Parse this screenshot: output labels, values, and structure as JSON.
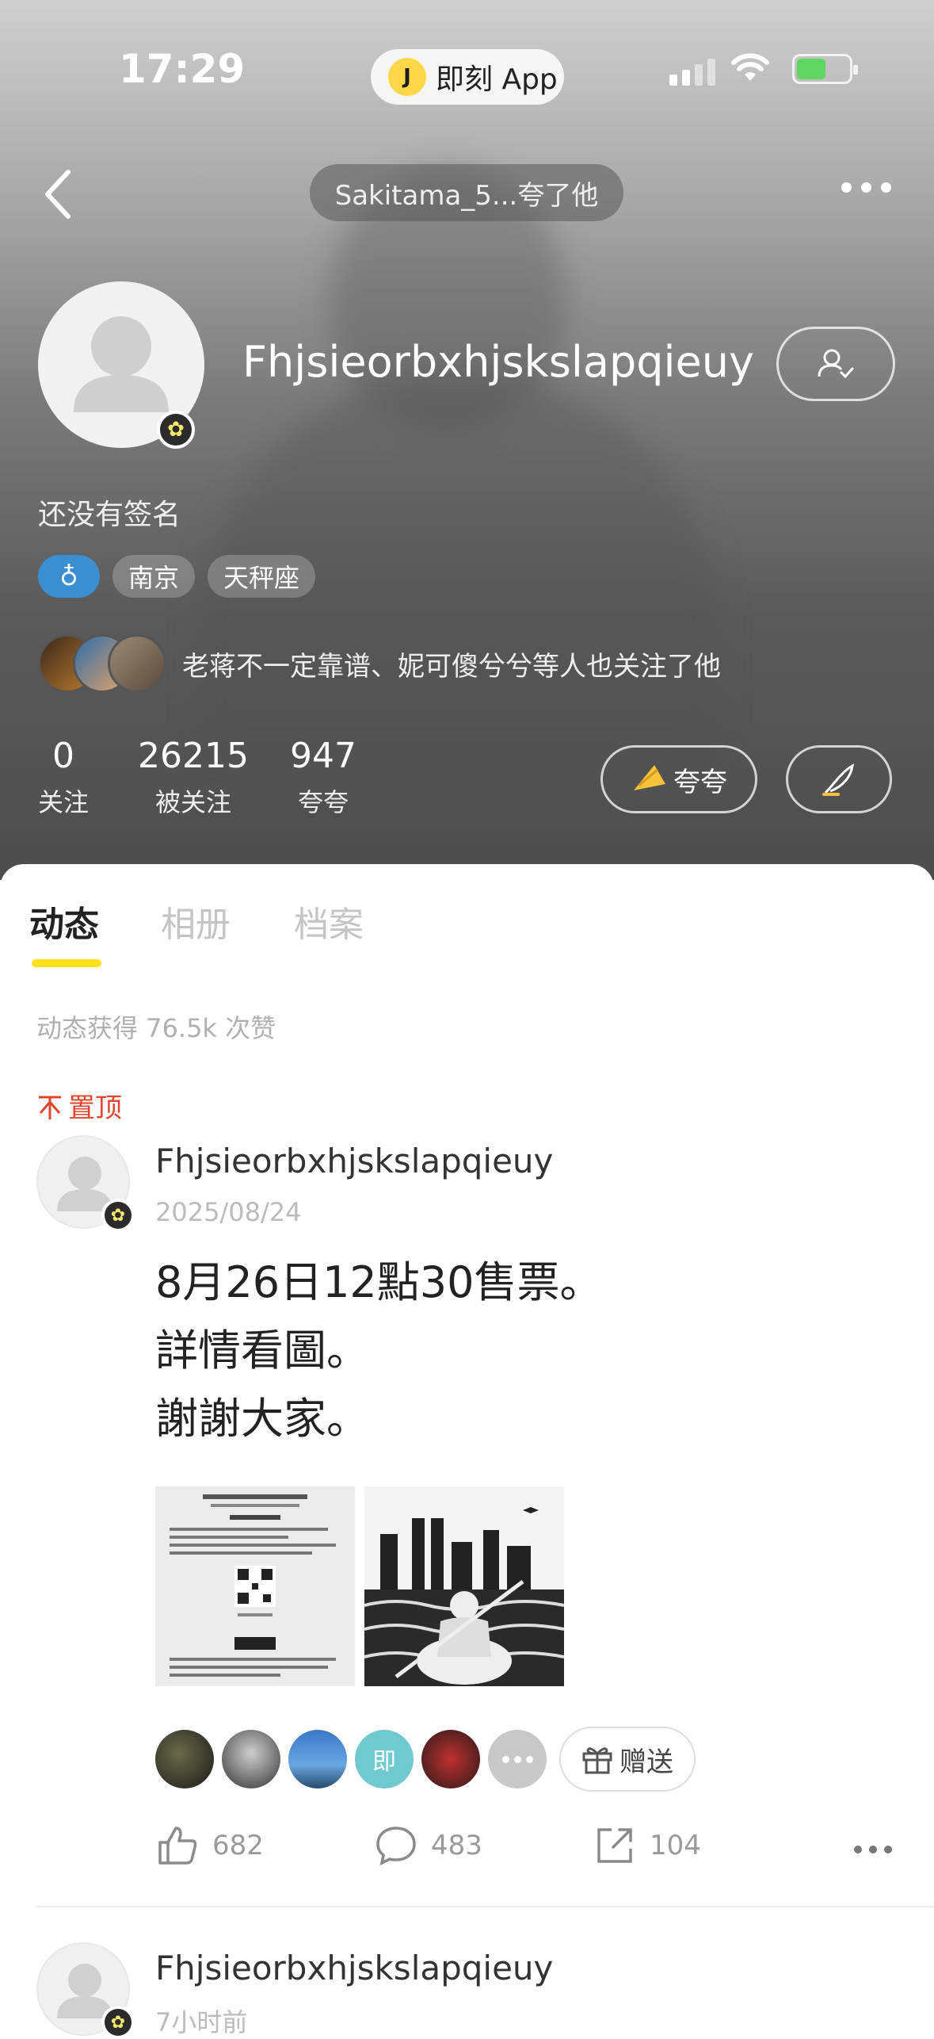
{
  "status_bar": {
    "time": "17:29",
    "app_pill": "即刻 App"
  },
  "nav": {
    "title_pill": "Sakitama_5...夸了他"
  },
  "profile": {
    "username": "Fhjsieorbxhjskslapqieuy",
    "bio": "还没有签名",
    "tags": [
      "♁",
      "南京",
      "天秤座"
    ],
    "mutual_text": "老蒋不一定靠谱、妮可傻兮兮等人也关注了他",
    "stats": [
      {
        "value": "0",
        "label": "关注"
      },
      {
        "value": "26215",
        "label": "被关注"
      },
      {
        "value": "947",
        "label": "夸夸"
      }
    ],
    "praise_button": "夸夸"
  },
  "tabs": [
    "动态",
    "相册",
    "档案"
  ],
  "likes_summary": "动态获得 76.5k 次赞",
  "posts": [
    {
      "pinned_label": "置顶",
      "author": "Fhjsieorbxhjskslapqieuy",
      "date": "2025/08/24",
      "lines": [
        "8月26日12點30售票。",
        "詳情看圖。",
        "謝謝大家。"
      ],
      "gift_avatar_text": "即",
      "gift_label": "赠送",
      "likes": "682",
      "comments": "483",
      "shares": "104"
    },
    {
      "author": "Fhjsieorbxhjskslapqieuy",
      "date": "7小时前"
    }
  ],
  "colors": {
    "accent_yellow": "#ffe21c",
    "pinned_red": "#e2462f",
    "gender_blue": "#3b8fd0"
  }
}
